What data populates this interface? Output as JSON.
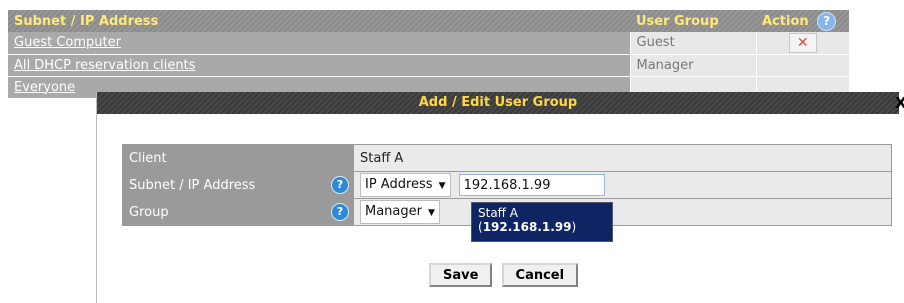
{
  "table": {
    "headers": {
      "subnet": "Subnet / IP Address",
      "user_group": "User Group",
      "action": "Action"
    },
    "rows": [
      {
        "subnet": "Guest Computer",
        "group": "Guest"
      },
      {
        "subnet": "All DHCP reservation clients",
        "group": "Manager"
      },
      {
        "subnet": "Everyone",
        "group": ""
      }
    ]
  },
  "modal": {
    "title": "Add / Edit User Group",
    "close": "X",
    "fields": {
      "client_label": "Client",
      "client_value": "Staff A",
      "subnet_label": "Subnet / IP Address",
      "subnet_type": "IP Address",
      "subnet_value": "192.168.1.99",
      "group_label": "Group",
      "group_value": "Manager"
    },
    "suggestion": {
      "name": "Staff A",
      "ip": "192.168.1.99"
    },
    "buttons": {
      "save": "Save",
      "cancel": "Cancel"
    }
  },
  "icons": {
    "help": "?",
    "delete": "✕",
    "dropdown": "▼"
  },
  "colors": {
    "header_text": "#ffe97a",
    "modal_title_text": "#ffd84a",
    "suggestion_bg": "#0f2563",
    "delete": "#e24b3b",
    "help_icon": "#2d8ad6"
  }
}
